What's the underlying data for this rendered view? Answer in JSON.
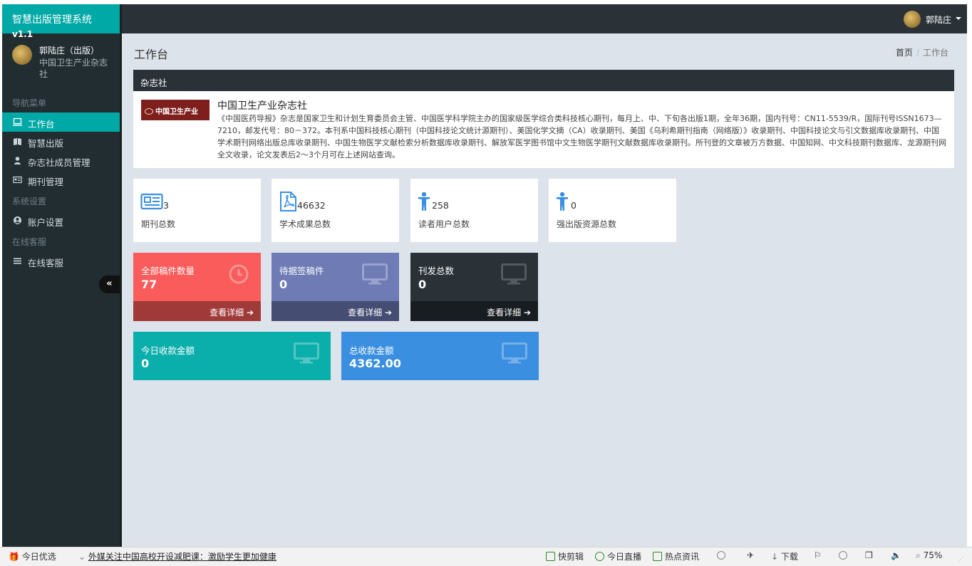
{
  "sidebar": {
    "brand": "智慧出版管理系统",
    "version": "v1.1",
    "user_name": "郭陆庄（出版）",
    "user_org": "中国卫生产业杂志社",
    "section_nav": "导航菜单",
    "section_settings": "系统设置",
    "section_service": "在线客服",
    "items": [
      {
        "label": "工作台",
        "icon": "monitor-icon"
      },
      {
        "label": "智慧出版",
        "icon": "book-icon"
      },
      {
        "label": "杂志社成员管理",
        "icon": "user-icon"
      },
      {
        "label": "期刊管理",
        "icon": "newspaper-icon"
      },
      {
        "label": "账户设置",
        "icon": "user-circle-icon"
      },
      {
        "label": "在线客服",
        "icon": "list-icon"
      }
    ],
    "collapse_glyph": "«"
  },
  "topbar": {
    "user_name": "郭陆庄"
  },
  "page": {
    "title": "工作台",
    "breadcrumb_home": "首页",
    "breadcrumb_sep": "/",
    "breadcrumb_current": "工作台"
  },
  "magazine": {
    "section_title": "杂志社",
    "logo_text": "中国卫生产业",
    "name": "中国卫生产业杂志社",
    "description": "《中国医药导报》杂志是国家卫生和计划生育委员会主管、中国医学科学院主办的国家级医学综合类科技核心期刊，每月上、中、下旬各出版1期，全年36期，国内刊号：CN11-5539/R，国际刊号ISSN1673—7210，邮发代号：80－372。本刊系中国科技核心期刊（中国科技论文统计源期刊）、美国化学文摘（CA）收录期刊、美国《乌利希期刊指南（网络版）》收录期刊、中国科技论文与引文数据库收录期刊、中国学术期刊网络出版总库收录期刊、中国生物医学文献检索分析数据库收录期刊、解放军医学图书馆中文生物医学期刊文献数据库收录期刊。所刊登的文章被万方数据、中国知网、中文科技期刊数据库、龙源期刊网全文收录，论文发表后2～3个月可在上述网站查询。"
  },
  "stats": [
    {
      "value": "3",
      "label": "期刊总数",
      "icon": "newspaper-icon"
    },
    {
      "value": "46632",
      "label": "学术成果总数",
      "icon": "pdf-icon"
    },
    {
      "value": "258",
      "label": "读者用户总数",
      "icon": "person-icon"
    },
    {
      "value": "0",
      "label": "强出版资源总数",
      "icon": "person-icon"
    }
  ],
  "cards": [
    {
      "title": "全部稿件数量",
      "value": "77",
      "link": "查看详细",
      "icon": "clock-icon",
      "color": "#fa5b5b",
      "footer_color": "#a03a39"
    },
    {
      "title": "待据签稿件",
      "value": "0",
      "link": "查看详细",
      "icon": "monitor-icon",
      "color": "#6e7bb5",
      "footer_color": "#454d73"
    },
    {
      "title": "刊发总数",
      "value": "0",
      "link": "查看详细",
      "icon": "monitor-icon",
      "color": "#2a3238",
      "footer_color": "#181d21"
    }
  ],
  "money": [
    {
      "title": "今日收款金额",
      "value": "0",
      "icon": "monitor-icon",
      "color": "#0aaeab"
    },
    {
      "title": "总收款金额",
      "value": "4362.00",
      "icon": "monitor-icon",
      "color": "#3a8fe0"
    }
  ],
  "statusbar": {
    "left_label": "今日优选",
    "news": "外媒关注中国高校开设减肥课：激励学生更加健康",
    "items": [
      "快剪辑",
      "今日直播",
      "热点资讯"
    ],
    "download": "下载",
    "zoom": "75%"
  }
}
